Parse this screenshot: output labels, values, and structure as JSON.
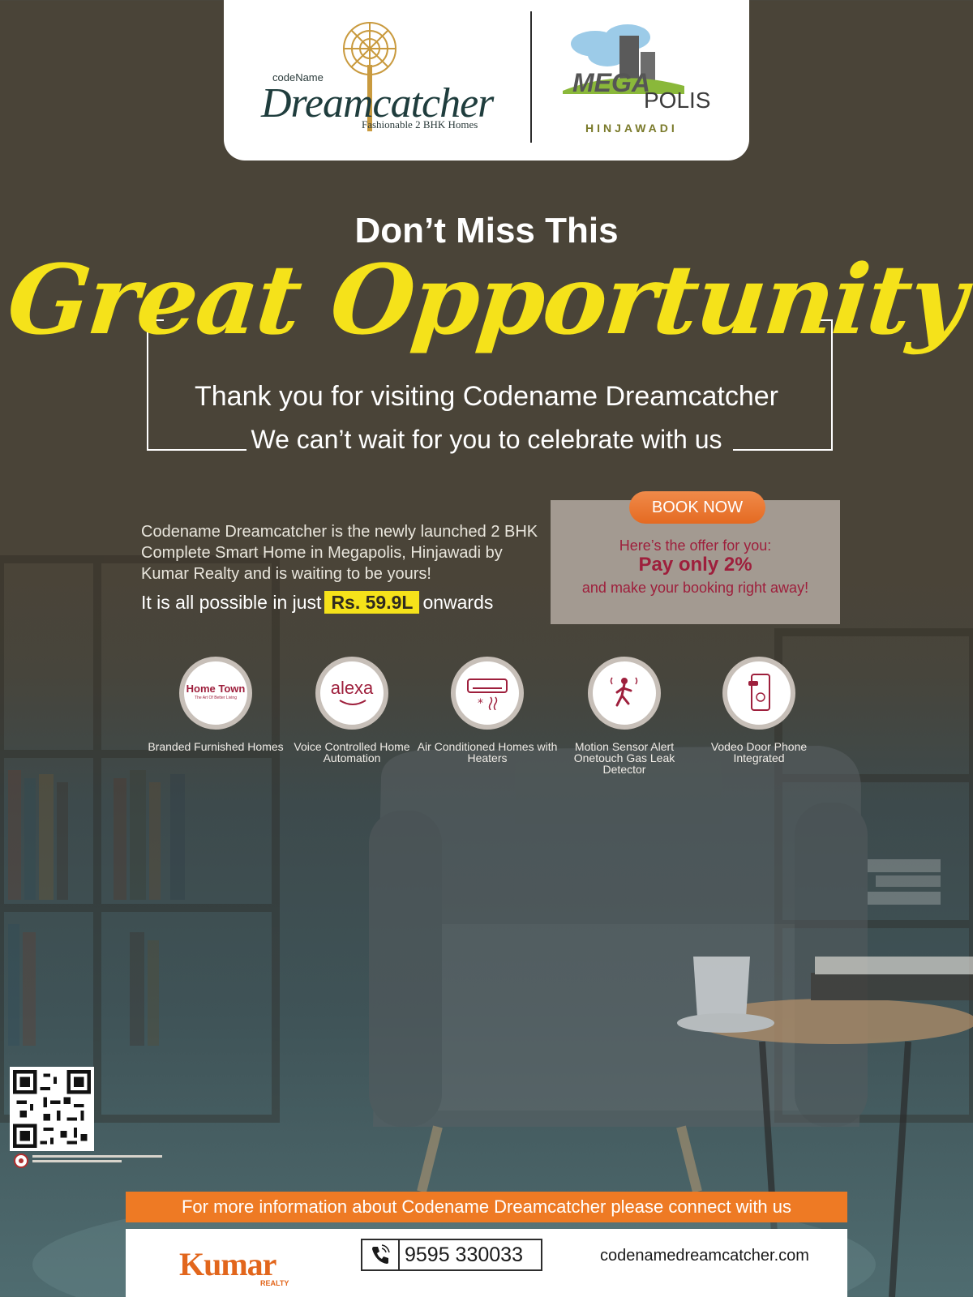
{
  "header": {
    "dreamcatcher_prefix": "codeName",
    "dreamcatcher_title": "Dreamcatcher",
    "dreamcatcher_tagline": "Fashionable 2 BHK Homes",
    "megapolis_mega": "MEGA",
    "megapolis_polis": "POLIS",
    "megapolis_location": "HINJAWADI"
  },
  "hero": {
    "kicker": "Don’t Miss This",
    "headline": "Great Opportunity",
    "thanks": "Thank you for visiting Codename Dreamcatcher",
    "celebrate": "We can’t wait for you to celebrate with us"
  },
  "description": {
    "text": "Codename Dreamcatcher is the newly launched 2 BHK Complete Smart Home in Megapolis, Hinjawadi by Kumar Realty and is waiting to be yours!",
    "price_prefix": "It is all possible in just",
    "price": "Rs. 59.9L",
    "price_suffix": "onwards"
  },
  "offer": {
    "button_label": "BOOK NOW",
    "intro": "Here’s the offer for you:",
    "main": "Pay only 2%",
    "sub": "and make your booking right away!"
  },
  "features": [
    {
      "icon": "home-town-logo-icon",
      "label": "Branded Furnished Homes",
      "logo_text": "Home Town",
      "logo_sub": "The Art Of Better Living"
    },
    {
      "icon": "alexa-logo-icon",
      "label": "Voice Controlled Home Automation",
      "logo_text": "alexa"
    },
    {
      "icon": "air-conditioner-icon",
      "label": "Air Conditioned Homes with Heaters"
    },
    {
      "icon": "motion-sensor-icon",
      "label": "Motion Sensor Alert Onetouch Gas Leak Detector"
    },
    {
      "icon": "door-phone-icon",
      "label": "Vodeo Door Phone Integrated"
    }
  ],
  "footer": {
    "info": "For more information about Codename Dreamcatcher please connect with us",
    "brand": "Kumar",
    "brand_sub": "REALTY",
    "phone": "9595 330033",
    "website": "codenamedreamcatcher.com"
  },
  "colors": {
    "accent_yellow": "#f5e21a",
    "offer_red": "#9e1f3c",
    "orange": "#ee7a24",
    "bg_top": "#4a4438"
  }
}
